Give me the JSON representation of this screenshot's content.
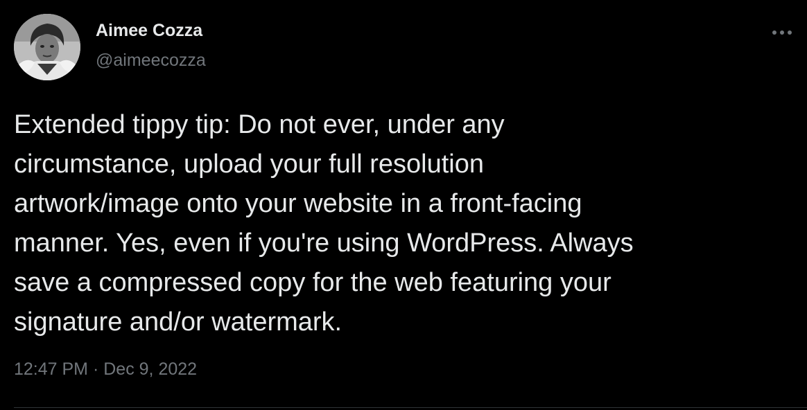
{
  "author": {
    "display_name": "Aimee Cozza",
    "handle": "@aimeecozza"
  },
  "more_icon": "more-horizontal-icon",
  "tweet": {
    "text": "Extended tippy tip: Do not ever, under any\ncircumstance, upload your full resolution\nartwork/image onto your website in a front-facing\nmanner. Yes, even if you're using WordPress. Always\nsave a compressed copy for the web featuring your\nsignature and/or watermark.",
    "time": "12:47 PM",
    "separator": "·",
    "date": "Dec 9, 2022"
  },
  "colors": {
    "background": "#000000",
    "text_primary": "#e7e9ea",
    "text_secondary": "#71767b",
    "divider": "#2f3336"
  }
}
